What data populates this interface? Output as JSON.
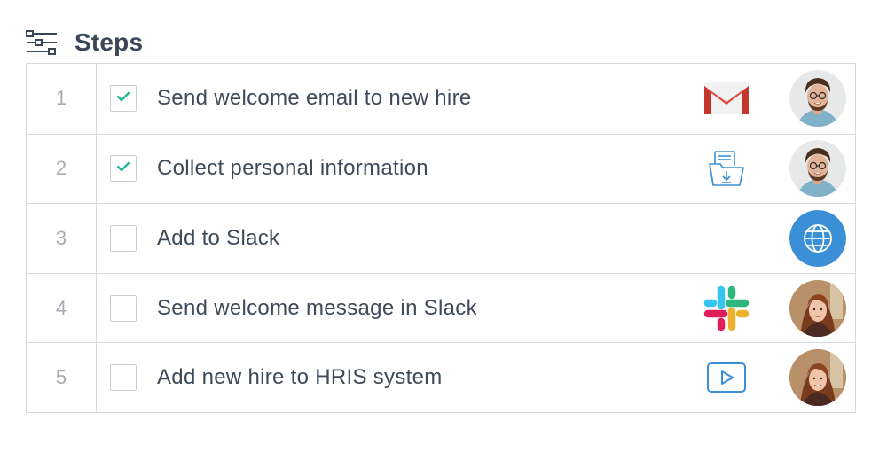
{
  "header": {
    "title": "Steps",
    "icon": "workflow-steps-icon"
  },
  "colors": {
    "check": "#2bb598",
    "border": "#d6d9dd",
    "globe": "#3a8fd6",
    "gmail_red": "#e0463a",
    "file_blue": "#3a8fd6"
  },
  "steps": [
    {
      "number": "1",
      "label": "Send welcome email to new hire",
      "checked": true,
      "app_icon": "gmail-icon",
      "assignee": "man-avatar"
    },
    {
      "number": "2",
      "label": "Collect personal information",
      "checked": true,
      "app_icon": "file-download-icon",
      "assignee": "man-avatar"
    },
    {
      "number": "3",
      "label": "Add to Slack",
      "checked": false,
      "app_icon": "",
      "assignee": "globe-icon"
    },
    {
      "number": "4",
      "label": "Send welcome message in Slack",
      "checked": false,
      "app_icon": "slack-icon",
      "assignee": "woman-avatar"
    },
    {
      "number": "5",
      "label": "Add new hire to HRIS system",
      "checked": false,
      "app_icon": "play-video-icon",
      "assignee": "woman-avatar"
    }
  ]
}
